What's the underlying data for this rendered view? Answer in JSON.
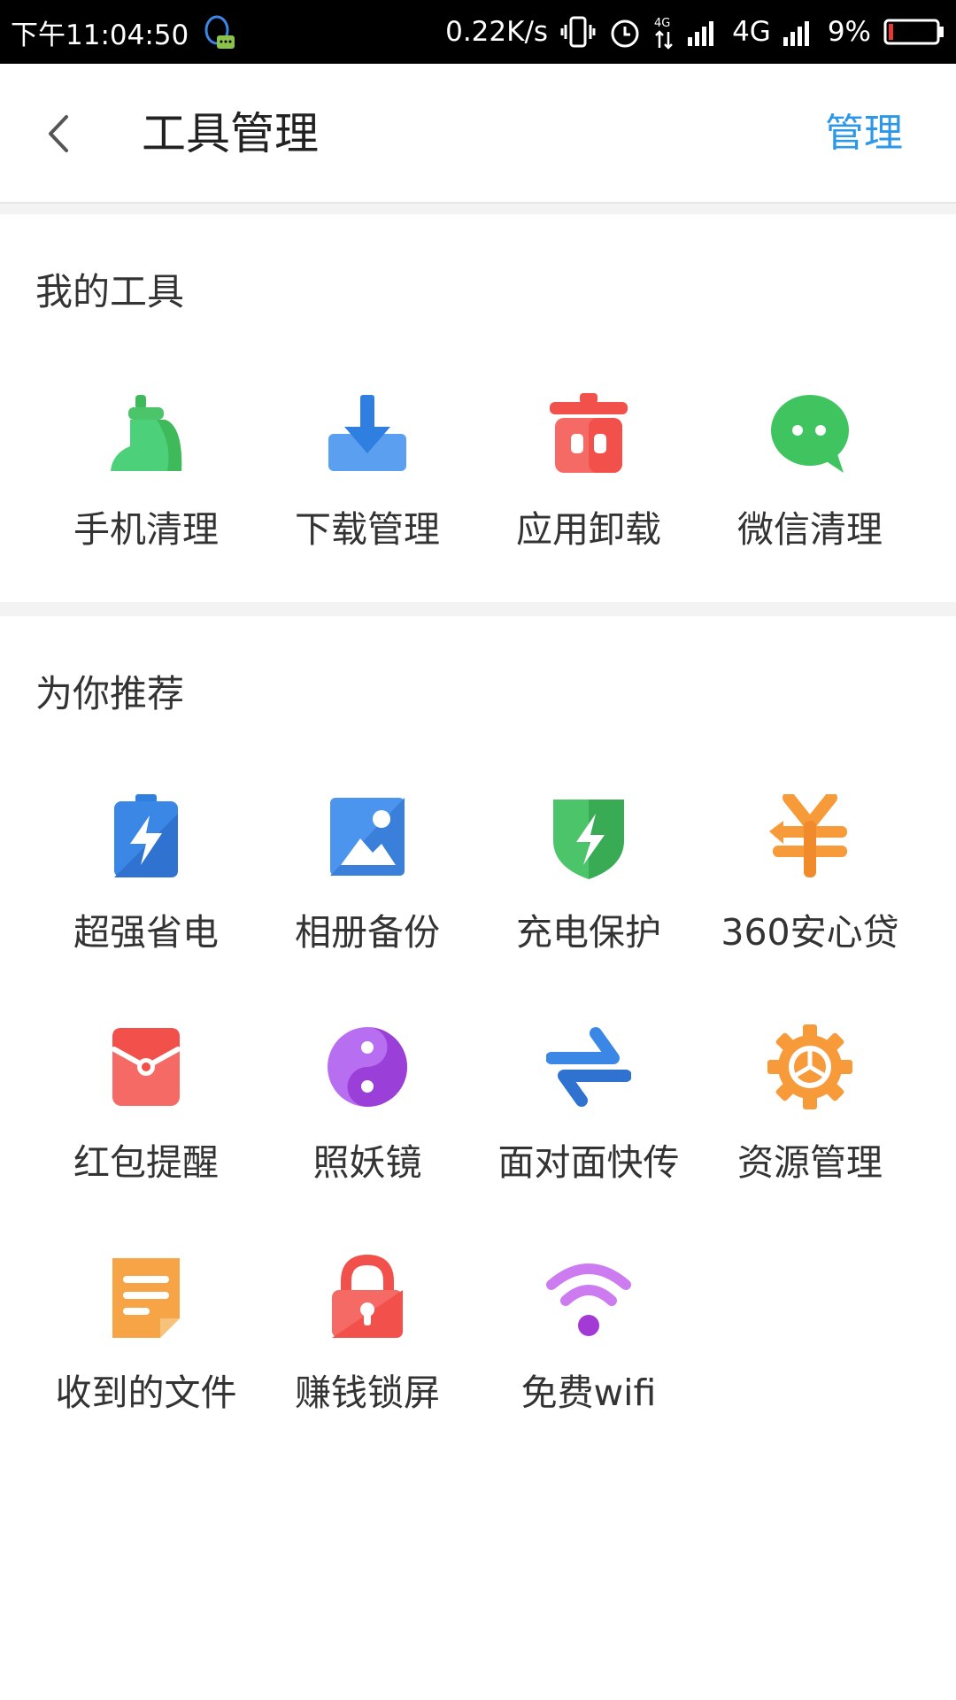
{
  "status_bar": {
    "time": "下午11:04:50",
    "speed": "0.22K/s",
    "network": "4G",
    "battery": "9%"
  },
  "header": {
    "title": "工具管理",
    "manage_label": "管理"
  },
  "my_tools": {
    "title": "我的工具",
    "items": [
      {
        "label": "手机清理",
        "icon": "broom-icon",
        "color": "#4cc46a"
      },
      {
        "label": "下载管理",
        "icon": "download-icon",
        "color": "#3a87e6"
      },
      {
        "label": "应用卸载",
        "icon": "trash-icon",
        "color": "#f2504a"
      },
      {
        "label": "微信清理",
        "icon": "wechat-icon",
        "color": "#3fc45f"
      }
    ]
  },
  "recommended": {
    "title": "为你推荐",
    "items": [
      {
        "label": "超强省电",
        "icon": "battery-icon",
        "color": "#3a87e6"
      },
      {
        "label": "相册备份",
        "icon": "photo-icon",
        "color": "#3a87e6"
      },
      {
        "label": "充电保护",
        "icon": "shield-icon",
        "color": "#3fba5a"
      },
      {
        "label": "360安心贷",
        "icon": "yen-icon",
        "color": "#f79a3a"
      },
      {
        "label": "红包提醒",
        "icon": "red-envelope-icon",
        "color": "#f2504a"
      },
      {
        "label": "照妖镜",
        "icon": "yin-yang-icon",
        "color": "#a25ce0"
      },
      {
        "label": "面对面快传",
        "icon": "transfer-icon",
        "color": "#3a87e6"
      },
      {
        "label": "资源管理",
        "icon": "gear-icon",
        "color": "#f79a3a"
      },
      {
        "label": "收到的文件",
        "icon": "document-icon",
        "color": "#f79a3a"
      },
      {
        "label": "赚钱锁屏",
        "icon": "lock-icon",
        "color": "#f2504a"
      },
      {
        "label": "免费wifi",
        "icon": "wifi-icon",
        "color": "#b75be0"
      }
    ]
  }
}
